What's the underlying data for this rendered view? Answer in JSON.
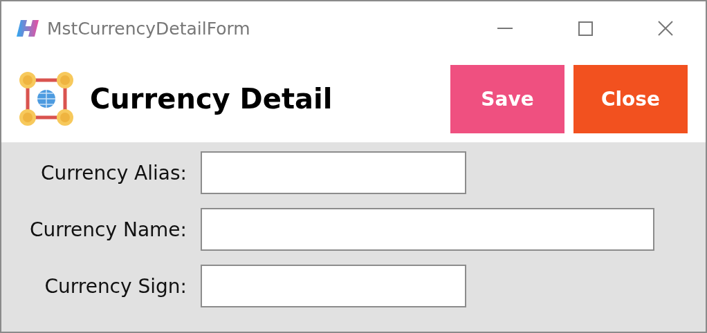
{
  "window": {
    "title": "MstCurrencyDetailForm"
  },
  "header": {
    "title": "Currency Detail"
  },
  "buttons": [
    {
      "label": "Save",
      "kind": "save"
    },
    {
      "label": "Close",
      "kind": "close"
    }
  ],
  "fields": [
    {
      "label": "Currency Alias:",
      "kind": "short"
    },
    {
      "label": "Currency Name:",
      "kind": "long"
    },
    {
      "label": "Currency Sign:",
      "kind": "short"
    }
  ]
}
